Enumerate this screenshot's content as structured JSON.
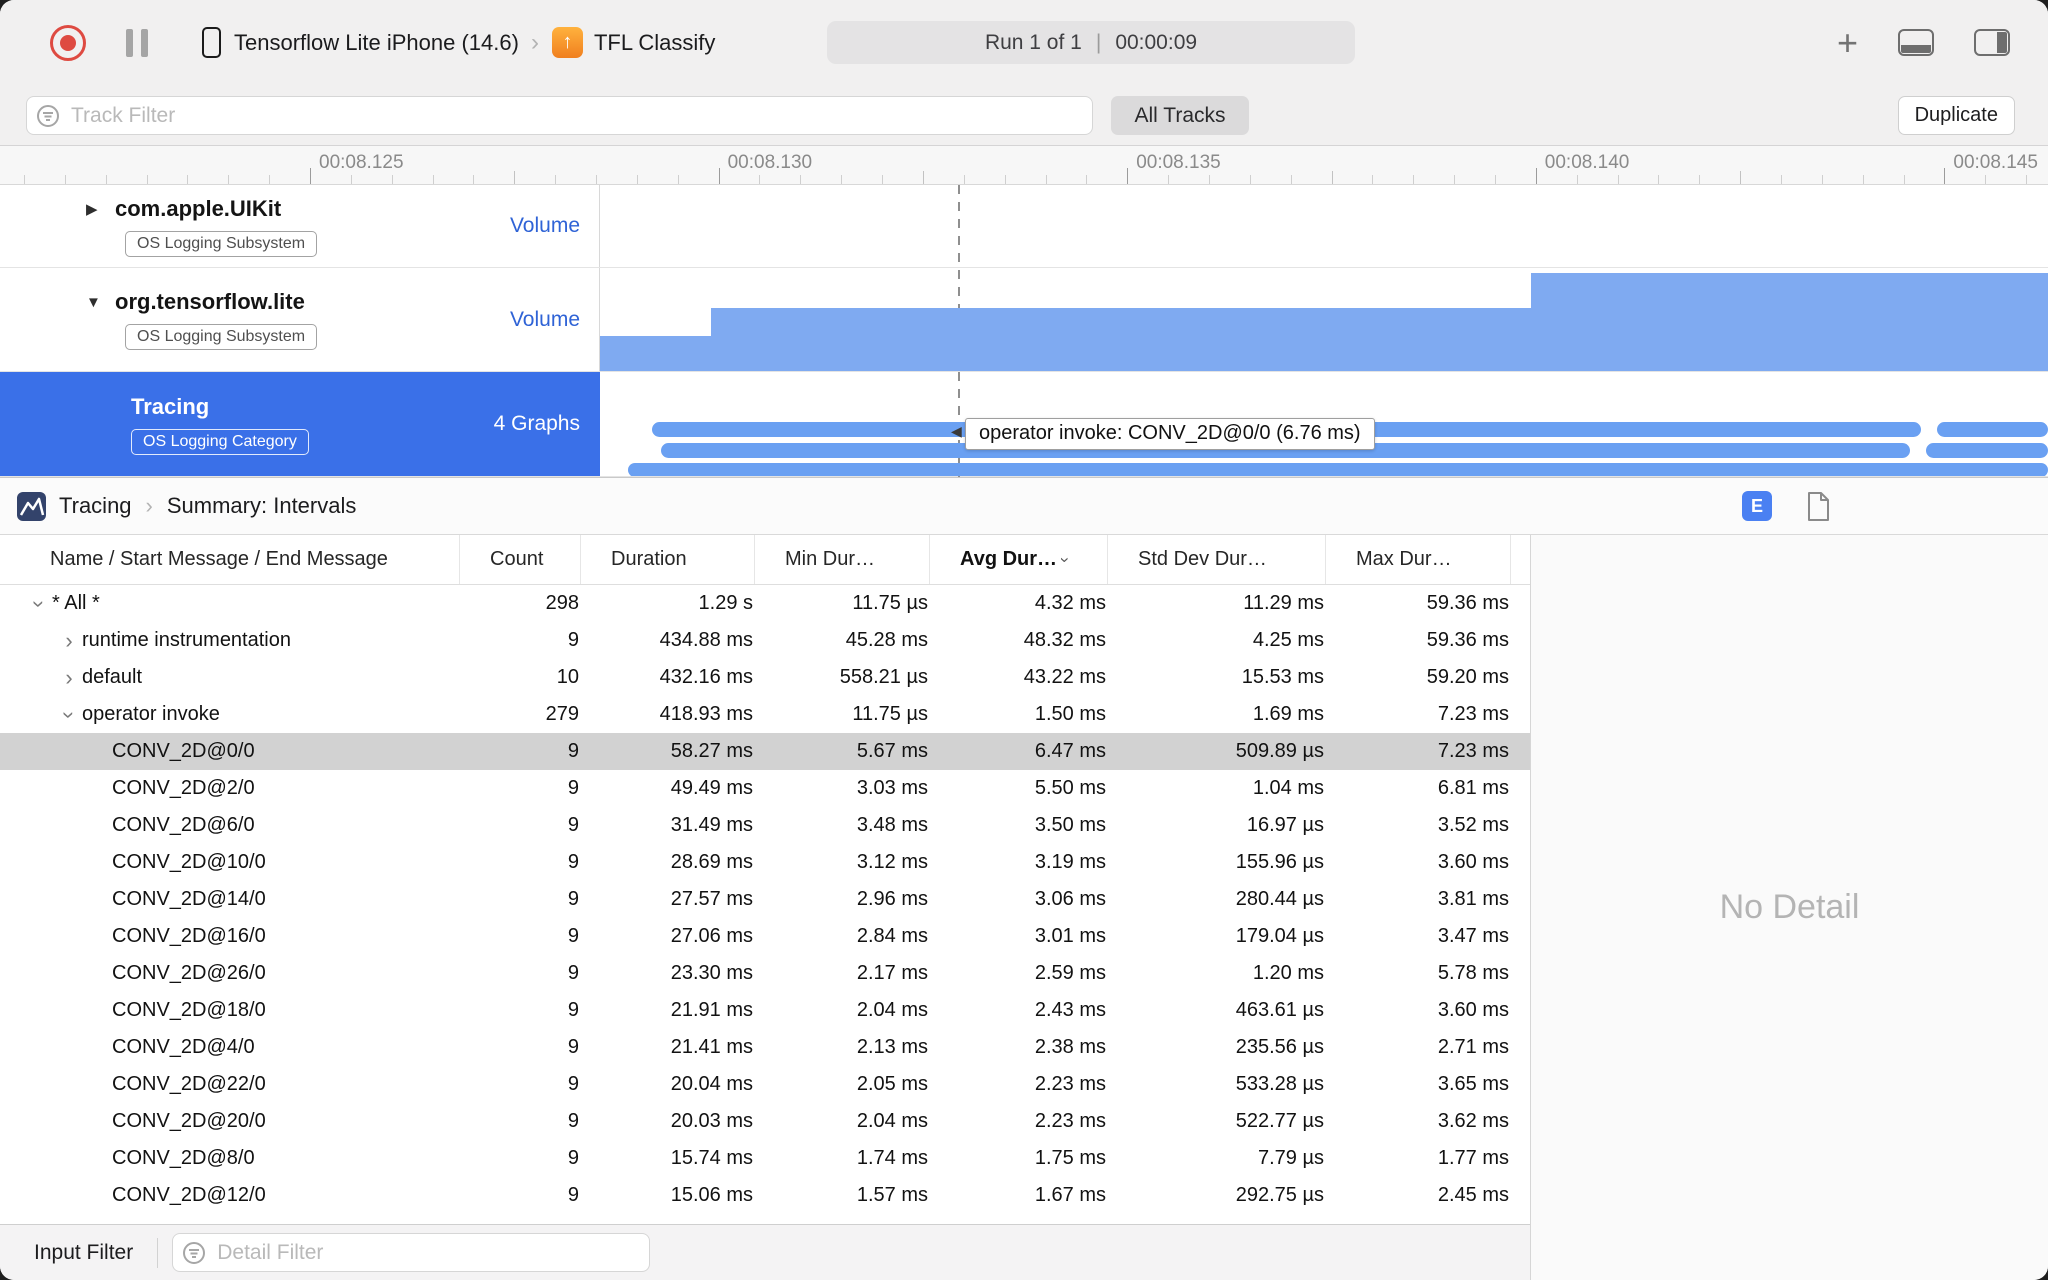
{
  "toolbar": {
    "device_name": "Tensorflow Lite iPhone (14.6)",
    "separator": "›",
    "app_name": "TFL Classify",
    "run_label": "Run 1 of 1",
    "run_divider": "|",
    "run_time": "00:00:09"
  },
  "filter_bar": {
    "track_filter_placeholder": "Track Filter",
    "all_tracks": "All Tracks",
    "duplicate": "Duplicate"
  },
  "timeline": {
    "ruler_labels": [
      "00:08.125",
      "00:08.130",
      "00:08.135",
      "00:08.140",
      "00:08.145"
    ],
    "tooltip": "operator invoke: CONV_2D@0/0 (6.76 ms)"
  },
  "tracks": [
    {
      "name": "com.apple.UIKit",
      "badge": "OS Logging Subsystem",
      "meta": "Volume",
      "disclosure": "collapsed",
      "selected": false,
      "lane": {
        "type": "empty"
      }
    },
    {
      "name": "org.tensorflow.lite",
      "badge": "OS Logging Subsystem",
      "meta": "Volume",
      "disclosure": "expanded",
      "selected": false,
      "lane": {
        "type": "volume",
        "color": "#7faaf1",
        "segments": [
          {
            "x0": 0.0,
            "x1": 0.077,
            "h": 0.34
          },
          {
            "x0": 0.077,
            "x1": 0.643,
            "h": 0.61
          },
          {
            "x0": 0.643,
            "x1": 1.0,
            "h": 0.955
          }
        ]
      }
    },
    {
      "name": "Tracing",
      "badge": "OS Logging Category",
      "meta": "4 Graphs",
      "disclosure": "none",
      "selected": true,
      "lane": {
        "type": "intervals",
        "color": "#6aa0f2",
        "rows": [
          {
            "y": 50,
            "h": 15,
            "segments": [
              [
                0.036,
                0.912
              ],
              [
                0.923,
                1.0
              ]
            ]
          },
          {
            "y": 71,
            "h": 15,
            "segments": [
              [
                0.042,
                0.905
              ],
              [
                0.916,
                1.0
              ]
            ]
          },
          {
            "y": 91,
            "h": 14,
            "segments": [
              [
                0.019,
                1.0
              ]
            ]
          }
        ]
      }
    }
  ],
  "detail_header": {
    "breadcrumb_root": "Tracing",
    "breadcrumb_page": "Summary: Intervals",
    "view_toggle": "E"
  },
  "table": {
    "columns": [
      {
        "label": "Name / Start Message / End Message",
        "sorted": false
      },
      {
        "label": "Count",
        "sorted": false
      },
      {
        "label": "Duration",
        "sorted": false
      },
      {
        "label": "Min Dur…",
        "sorted": false
      },
      {
        "label": "Avg Dur…",
        "sorted": true
      },
      {
        "label": "Std Dev Dur…",
        "sorted": false
      },
      {
        "label": "Max Dur…",
        "sorted": false
      }
    ],
    "rows": [
      {
        "name": "* All *",
        "depth": 0,
        "chevron": "expanded",
        "selected": false,
        "count": "298",
        "duration": "1.29 s",
        "min": "11.75 µs",
        "avg": "4.32 ms",
        "std": "11.29 ms",
        "max": "59.36 ms"
      },
      {
        "name": "runtime instrumentation",
        "depth": 1,
        "chevron": "collapsed",
        "selected": false,
        "count": "9",
        "duration": "434.88 ms",
        "min": "45.28 ms",
        "avg": "48.32 ms",
        "std": "4.25 ms",
        "max": "59.36 ms"
      },
      {
        "name": "default",
        "depth": 1,
        "chevron": "collapsed",
        "selected": false,
        "count": "10",
        "duration": "432.16 ms",
        "min": "558.21 µs",
        "avg": "43.22 ms",
        "std": "15.53 ms",
        "max": "59.20 ms"
      },
      {
        "name": "operator invoke",
        "depth": 1,
        "chevron": "expanded",
        "selected": false,
        "count": "279",
        "duration": "418.93 ms",
        "min": "11.75 µs",
        "avg": "1.50 ms",
        "std": "1.69 ms",
        "max": "7.23 ms"
      },
      {
        "name": "CONV_2D@0/0",
        "depth": 2,
        "chevron": "none",
        "selected": true,
        "count": "9",
        "duration": "58.27 ms",
        "min": "5.67 ms",
        "avg": "6.47 ms",
        "std": "509.89 µs",
        "max": "7.23 ms"
      },
      {
        "name": "CONV_2D@2/0",
        "depth": 2,
        "chevron": "none",
        "selected": false,
        "count": "9",
        "duration": "49.49 ms",
        "min": "3.03 ms",
        "avg": "5.50 ms",
        "std": "1.04 ms",
        "max": "6.81 ms"
      },
      {
        "name": "CONV_2D@6/0",
        "depth": 2,
        "chevron": "none",
        "selected": false,
        "count": "9",
        "duration": "31.49 ms",
        "min": "3.48 ms",
        "avg": "3.50 ms",
        "std": "16.97 µs",
        "max": "3.52 ms"
      },
      {
        "name": "CONV_2D@10/0",
        "depth": 2,
        "chevron": "none",
        "selected": false,
        "count": "9",
        "duration": "28.69 ms",
        "min": "3.12 ms",
        "avg": "3.19 ms",
        "std": "155.96 µs",
        "max": "3.60 ms"
      },
      {
        "name": "CONV_2D@14/0",
        "depth": 2,
        "chevron": "none",
        "selected": false,
        "count": "9",
        "duration": "27.57 ms",
        "min": "2.96 ms",
        "avg": "3.06 ms",
        "std": "280.44 µs",
        "max": "3.81 ms"
      },
      {
        "name": "CONV_2D@16/0",
        "depth": 2,
        "chevron": "none",
        "selected": false,
        "count": "9",
        "duration": "27.06 ms",
        "min": "2.84 ms",
        "avg": "3.01 ms",
        "std": "179.04 µs",
        "max": "3.47 ms"
      },
      {
        "name": "CONV_2D@26/0",
        "depth": 2,
        "chevron": "none",
        "selected": false,
        "count": "9",
        "duration": "23.30 ms",
        "min": "2.17 ms",
        "avg": "2.59 ms",
        "std": "1.20 ms",
        "max": "5.78 ms"
      },
      {
        "name": "CONV_2D@18/0",
        "depth": 2,
        "chevron": "none",
        "selected": false,
        "count": "9",
        "duration": "21.91 ms",
        "min": "2.04 ms",
        "avg": "2.43 ms",
        "std": "463.61 µs",
        "max": "3.60 ms"
      },
      {
        "name": "CONV_2D@4/0",
        "depth": 2,
        "chevron": "none",
        "selected": false,
        "count": "9",
        "duration": "21.41 ms",
        "min": "2.13 ms",
        "avg": "2.38 ms",
        "std": "235.56 µs",
        "max": "2.71 ms"
      },
      {
        "name": "CONV_2D@22/0",
        "depth": 2,
        "chevron": "none",
        "selected": false,
        "count": "9",
        "duration": "20.04 ms",
        "min": "2.05 ms",
        "avg": "2.23 ms",
        "std": "533.28 µs",
        "max": "3.65 ms"
      },
      {
        "name": "CONV_2D@20/0",
        "depth": 2,
        "chevron": "none",
        "selected": false,
        "count": "9",
        "duration": "20.03 ms",
        "min": "2.04 ms",
        "avg": "2.23 ms",
        "std": "522.77 µs",
        "max": "3.62 ms"
      },
      {
        "name": "CONV_2D@8/0",
        "depth": 2,
        "chevron": "none",
        "selected": false,
        "count": "9",
        "duration": "15.74 ms",
        "min": "1.74 ms",
        "avg": "1.75 ms",
        "std": "7.79 µs",
        "max": "1.77 ms"
      },
      {
        "name": "CONV_2D@12/0",
        "depth": 2,
        "chevron": "none",
        "selected": false,
        "count": "9",
        "duration": "15.06 ms",
        "min": "1.57 ms",
        "avg": "1.67 ms",
        "std": "292.75 µs",
        "max": "2.45 ms"
      }
    ]
  },
  "right_panel": {
    "empty_message": "No Detail"
  },
  "bottom_bar": {
    "label": "Input Filter",
    "detail_filter_placeholder": "Detail Filter"
  },
  "colors": {
    "accent_blue": "#3a70e8",
    "interval_blue": "#6aa0f2",
    "volume_blue": "#7faaf1",
    "selected_row_gray": "#d2d2d2"
  }
}
